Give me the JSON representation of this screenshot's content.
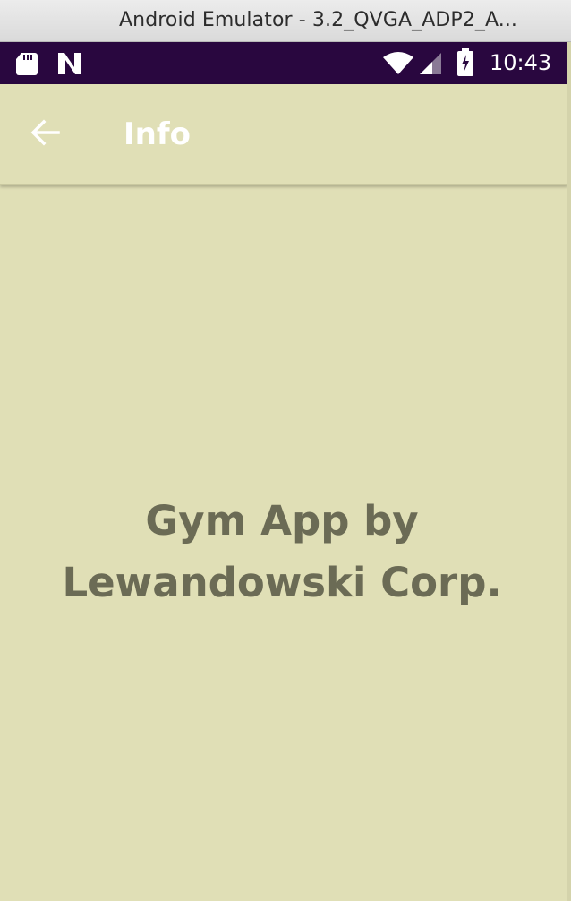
{
  "window": {
    "title": "Android Emulator - 3.2_QVGA_ADP2_A..."
  },
  "status_bar": {
    "time": "10:43",
    "icons": [
      "sd-card-icon",
      "n-notification-icon",
      "wifi-icon",
      "cell-signal-icon",
      "battery-charging-icon"
    ],
    "background": "#29073f"
  },
  "toolbar": {
    "title": "Info",
    "back_icon": "arrow-back-icon"
  },
  "content": {
    "line1": "Gym App by",
    "line2": "Lewandowski Corp."
  },
  "colors": {
    "background": "#e0dfb6",
    "text": "#6b6b55",
    "toolbar_text": "#ffffff"
  }
}
